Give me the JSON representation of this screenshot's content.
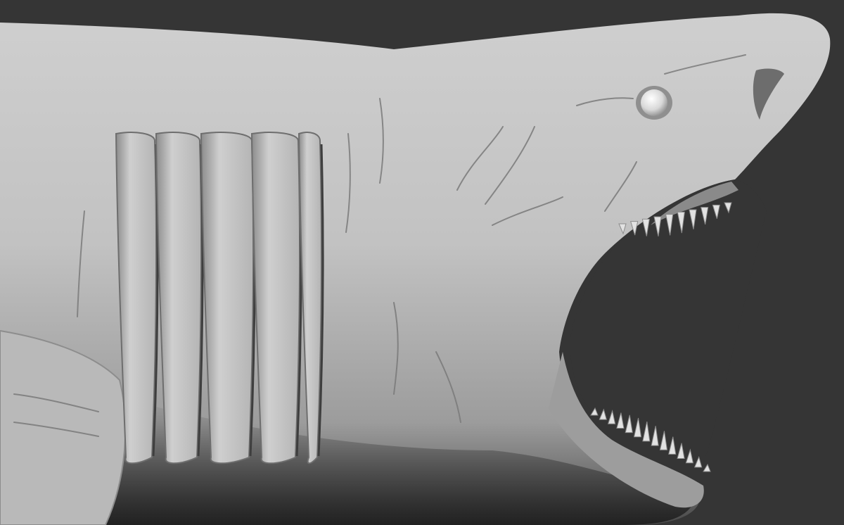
{
  "scene": {
    "subject": "sculpted-shark-head",
    "background_color": "#353535",
    "clay_color_light": "#c7c7c7",
    "clay_color_mid": "#a9a9a9",
    "clay_color_dark": "#5a5a5a",
    "mouth_color": "#232323",
    "tooth_color": "#e2e2e2",
    "eye_color": "#f0f0f0",
    "gill_slit_count": 5,
    "upper_tooth_count": 10,
    "lower_tooth_count": 14
  }
}
